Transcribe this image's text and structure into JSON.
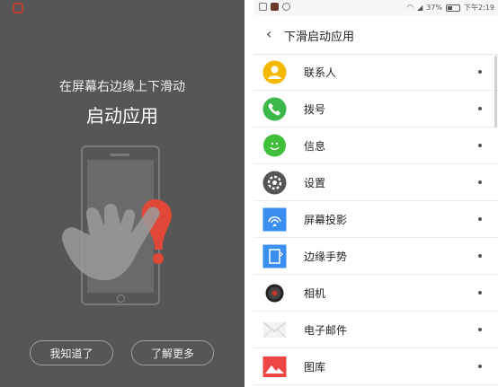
{
  "tutorial": {
    "instruction": "在屏幕右边缘上下滑动",
    "title": "启动应用",
    "buttons": {
      "ok": "我知道了",
      "more": "了解更多"
    }
  },
  "status_bar": {
    "battery": "37%",
    "time": "下午2:19"
  },
  "header": {
    "title": "下滑启动应用"
  },
  "apps": [
    {
      "name": "联系人",
      "icon": "contacts-icon",
      "color": "#f5b800"
    },
    {
      "name": "拨号",
      "icon": "phone-icon",
      "color": "#3cb84a"
    },
    {
      "name": "信息",
      "icon": "message-icon",
      "color": "#3fbf3a"
    },
    {
      "name": "设置",
      "icon": "gear-icon",
      "color": "#555555"
    },
    {
      "name": "屏幕投影",
      "icon": "screen-cast-icon",
      "color": "#3a8ef0"
    },
    {
      "name": "边缘手势",
      "icon": "edge-gesture-icon",
      "color": "#3a8ef0"
    },
    {
      "name": "相机",
      "icon": "camera-icon",
      "color": "#333333"
    },
    {
      "name": "电子邮件",
      "icon": "email-icon",
      "color": "#e8e8e8"
    },
    {
      "name": "图库",
      "icon": "gallery-icon",
      "color": "#ee4545"
    }
  ]
}
